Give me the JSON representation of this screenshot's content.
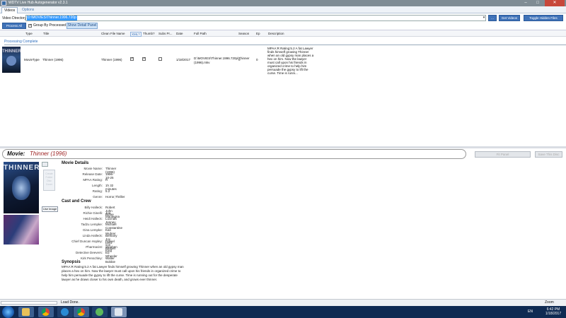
{
  "window": {
    "title": "WDTV Live Hub Autogenerator v2.3.1"
  },
  "tabs": [
    {
      "label": "Videos"
    },
    {
      "label": "Options"
    }
  ],
  "toolbar": {
    "directory_label": "Video Directory",
    "directory_value": "D:\\MOVIES\\Thinner.1996.720p",
    "get_videos": "Get Videos",
    "toggle_hidden": "Toggle Hidden Files",
    "process_all": "Process All",
    "group_by_processed": "Group By Processed",
    "show_detail_panel": "Show Detail Panel"
  },
  "grid": {
    "columns": [
      "Type",
      "Title",
      "Clean File Name",
      "XML?",
      "Thumb?",
      "Subs Pr...",
      "Date",
      "Full Path",
      "Season",
      "Ep",
      "Description"
    ],
    "group_header": "Processing Complete",
    "rows": [
      {
        "type": "MovieType",
        "title": "Thinner (1996)",
        "clean_file_name": "Thinner (1996)",
        "xml": true,
        "thumb": true,
        "subs": false,
        "date": "1/18/2017",
        "full_path": "D:\\MOVIES\\Thinner.1996.720p\\Thinner (1996).mkv",
        "season": "0",
        "ep": "0",
        "description": "MPAA:R Rating:5.2 A fat Lawyer finds himself growing Thinner when an old gypsy man places a hex on him. Now the lawyer must call upon his friends in organized crime to help him persuade the gypsy to lift the curse. Time is runni..."
      }
    ]
  },
  "detail": {
    "movie_label": "Movie:",
    "movie_title": "Thinner (1996)",
    "fix_panel_button": "Fit Panel",
    "save_button": "Save This Disc",
    "poster_title": "THINNER",
    "thumb_button_label": "Create Folder Disc Cover",
    "use_image_button": "Use Image",
    "movie_details_heading": "Movie Details",
    "details": [
      {
        "label": "Movie Name:",
        "value": "Thinner (1996)"
      },
      {
        "label": "Release Date:",
        "value": "1996-10-25"
      },
      {
        "label": "MPAA Rating:",
        "value": "R"
      },
      {
        "label": "Length:",
        "value": "1h 32 minutes"
      },
      {
        "label": "Rating:",
        "value": "5.2"
      },
      {
        "label": "Genre:",
        "value": "Horror,Thriller"
      }
    ],
    "cast_heading": "Cast and Crew",
    "cast": [
      {
        "label": "Billy Halleck:",
        "value": "Robert John Burke"
      },
      {
        "label": "Richie Ginelli:",
        "value": "Joe Mantegna"
      },
      {
        "label": "Heidi Halleck:",
        "value": "Lucinda Jenney"
      },
      {
        "label": "Tadzu Lempke:",
        "value": "Michael Constantine"
      },
      {
        "label": "Gina Lempke:",
        "value": "Kari Wuhrer"
      },
      {
        "label": "Linda Halleck:",
        "value": "Bethany Joy Lenz"
      },
      {
        "label": "Chief Duncan Hopley:",
        "value": "Daniel von Bargen"
      },
      {
        "label": "Pharmacist:",
        "value": "Stephen King"
      },
      {
        "label": "Detective Deevers:",
        "value": "Ed Wheeler"
      },
      {
        "label": "Kirk Penschley:",
        "value": "Walter Bobbie"
      }
    ],
    "synopsis_heading": "Synopsis",
    "synopsis": "MPAA:R Rating:5.2 A fat Lawyer finds himself growing Thinner when an old gypsy man places a hex on him. Now the lawyer must call upon his friends in organized crime to help him persuade the gypsy to lift the curse. Time is running out for the desperate lawyer as he draws closer to his own death, and grows ever thinner."
  },
  "statusbar": {
    "status": "Load Done.",
    "zoom": "Zoom"
  },
  "taskbar": {
    "language": "EN",
    "time": "6:42 PM",
    "date": "1/18/2017"
  },
  "icons": {
    "close": "close-icon",
    "minimize": "minimize-icon",
    "maximize": "maximize-icon"
  }
}
